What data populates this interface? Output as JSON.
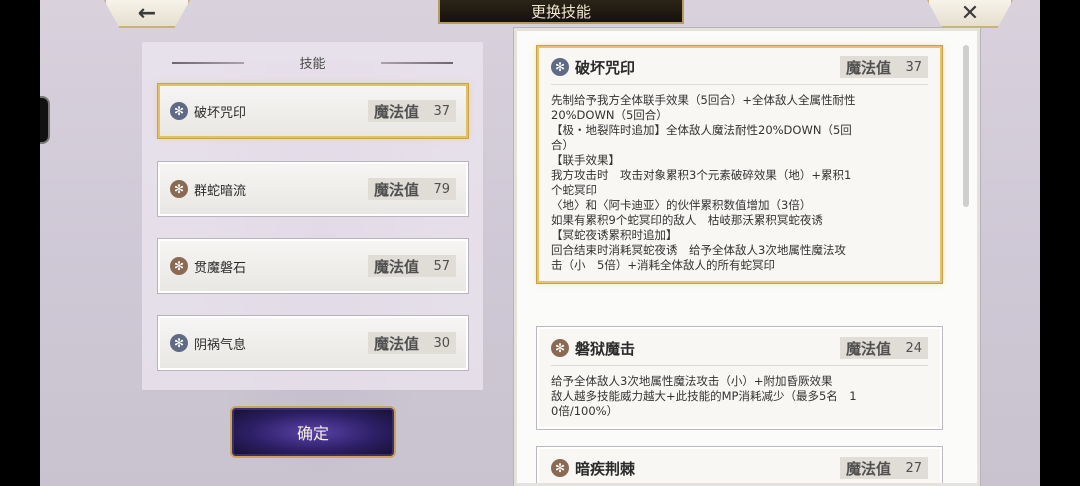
{
  "header": {
    "title": "更换技能",
    "back_icon": "←",
    "close_icon": "✕"
  },
  "left_panel": {
    "header": "技能",
    "skills": [
      {
        "name": "破坏咒印",
        "mp_label": "魔法值",
        "mp": "37",
        "icon": "snowflake-icon",
        "selected": true
      },
      {
        "name": "群蛇暗流",
        "mp_label": "魔法值",
        "mp": "79",
        "icon": "earth-icon",
        "selected": false
      },
      {
        "name": "贯魔磐石",
        "mp_label": "魔法值",
        "mp": "57",
        "icon": "earth-icon",
        "selected": false
      },
      {
        "name": "阴祸气息",
        "mp_label": "魔法值",
        "mp": "30",
        "icon": "snowflake-icon",
        "selected": false
      }
    ]
  },
  "confirm_button": "确定",
  "detail_cards": [
    {
      "name": "破坏咒印",
      "mp_label": "魔法值",
      "mp": "37",
      "lines": [
        "先制给予我方全体联手效果（5回合）+全体敌人全属性耐性",
        "20%DOWN（5回合）",
        "【极・地裂阵时追加】全体敌人魔法耐性20%DOWN（5回",
        "合）",
        "",
        "【联手效果】",
        "我方攻击时　攻击对象累积3个元素破碎效果（地）+累积1",
        "个蛇冥印",
        "〈地〉和〈阿卡迪亚〉的伙伴累积数值增加（3倍）",
        "如果有累积9个蛇冥印的敌人　枯岐那沃累积冥蛇夜诱",
        "",
        "【冥蛇夜诱累积时追加】",
        "回合结束时消耗冥蛇夜诱　给予全体敌人3次地属性魔法攻",
        "击（小　5倍）+消耗全体敌人的所有蛇冥印"
      ]
    },
    {
      "name": "磐狱魔击",
      "mp_label": "魔法值",
      "mp": "24",
      "lines": [
        "给予全体敌人3次地属性魔法攻击（小）+附加昏厥效果",
        "敌人越多技能威力越大+此技能的MP消耗减少（最多5名　1",
        "0倍/100%）"
      ]
    },
    {
      "name": "暗疾荆棘",
      "mp_label": "魔法值",
      "mp": "27",
      "lines": []
    }
  ],
  "colors": {
    "selected_border": "#e6c46c",
    "confirm_bg": "#2d1f66",
    "banner_bg": "#1f1912"
  }
}
